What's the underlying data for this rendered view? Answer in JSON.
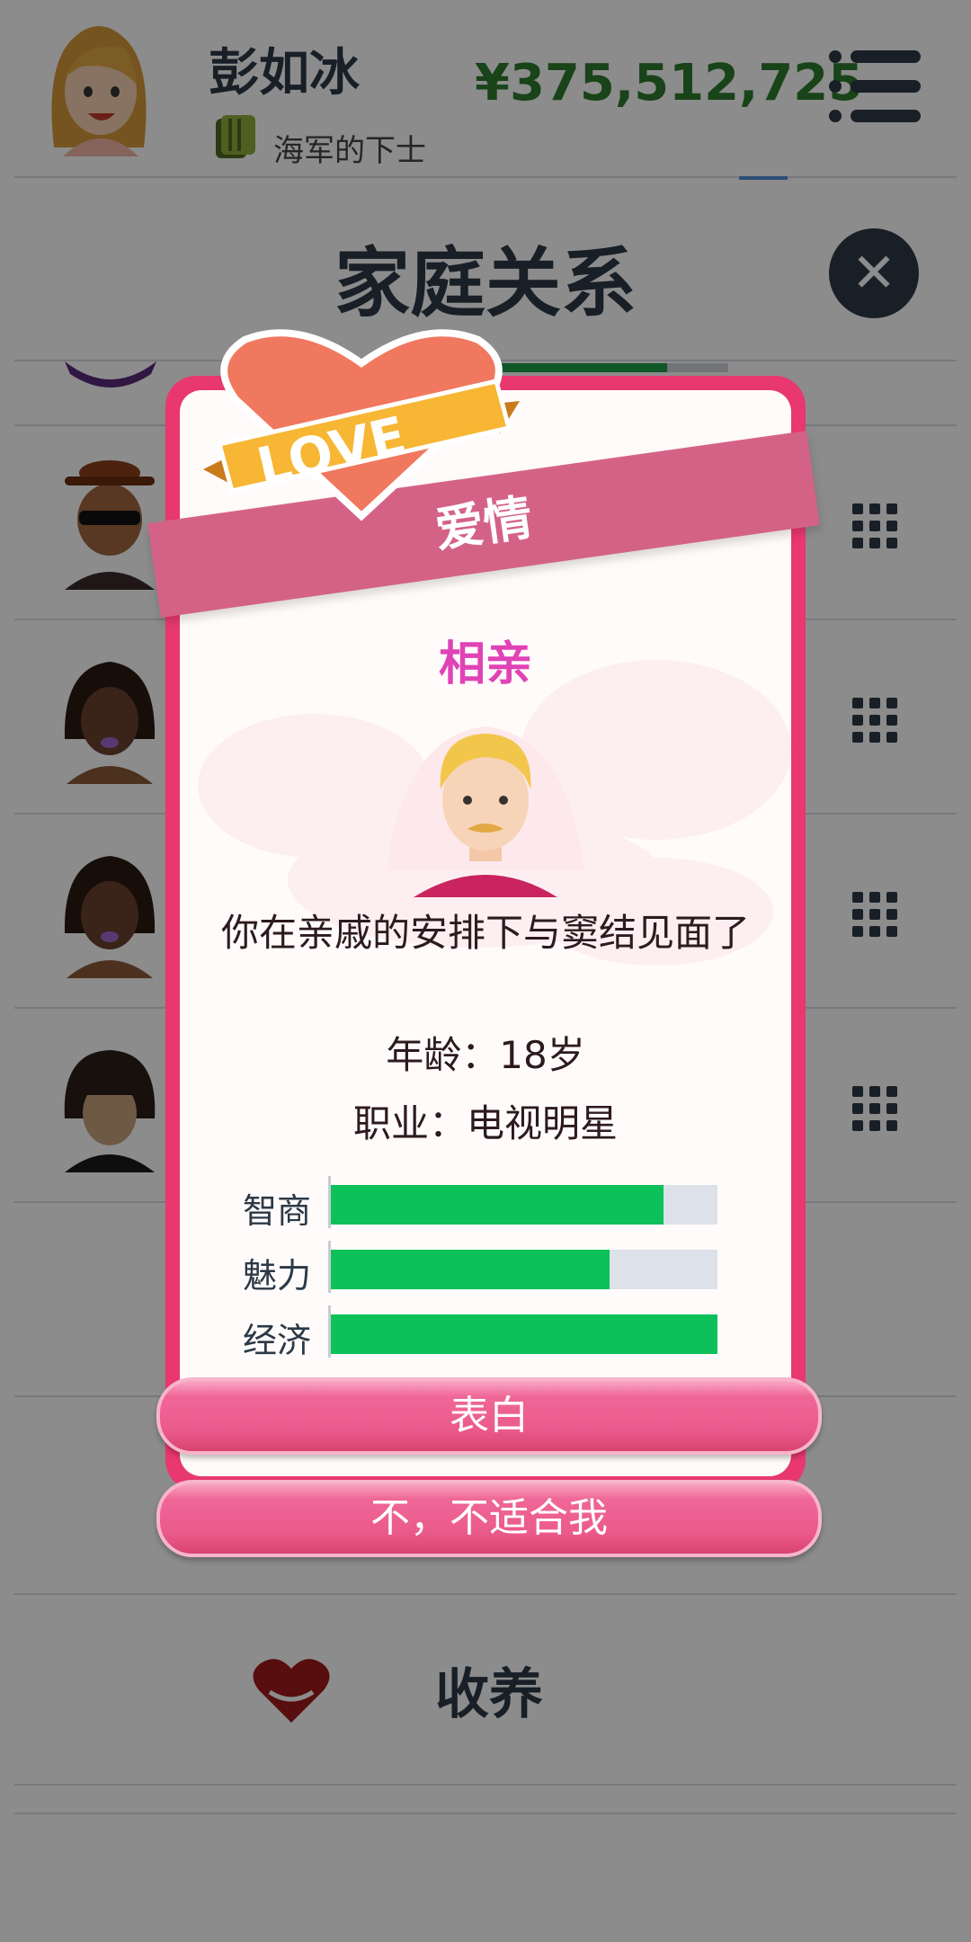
{
  "header": {
    "username": "彭如冰",
    "rank": "海军的下士",
    "money": "¥375,512,725"
  },
  "page": {
    "title": "家庭关系",
    "adopt_label": "收养"
  },
  "modal": {
    "ribbon_title": "爱情",
    "badge_text": "LOVE",
    "subtitle": "相亲",
    "description": "你在亲戚的安排下与窦结见面了",
    "age": "年龄：18岁",
    "job": "职业：电视明星",
    "stats": [
      {
        "label": "智商",
        "value": 0.86
      },
      {
        "label": "魅力",
        "value": 0.72
      },
      {
        "label": "经济",
        "value": 1.0
      }
    ],
    "confess_button": "表白",
    "decline_button": "不，不适合我"
  },
  "colors": {
    "money": "#2e7a2e",
    "modal_border": "#e8386f",
    "ribbon": "#d46287",
    "subtitle": "#e043b6",
    "stat_fill": "#0dc15a",
    "button": "#eb5a8c"
  }
}
